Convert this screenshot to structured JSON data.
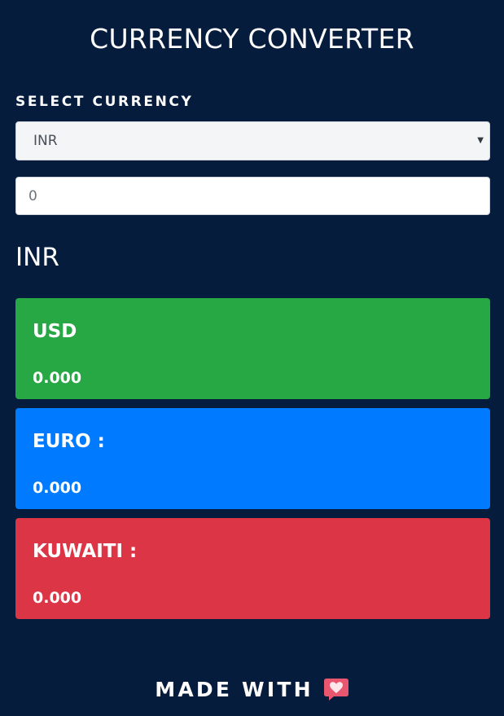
{
  "header": {
    "title": "CURRENCY CONVERTER"
  },
  "form": {
    "select_label": "SELECT CURRENCY",
    "selected_currency": "INR",
    "amount_placeholder": "0"
  },
  "result": {
    "heading": "INR"
  },
  "cards": [
    {
      "name": "USD",
      "value": "0.000",
      "color": "#28a745"
    },
    {
      "name": "EURO :",
      "value": "0.000",
      "color": "#007bff"
    },
    {
      "name": "KUWAITI :",
      "value": "0.000",
      "color": "#dc3545"
    }
  ],
  "footer": {
    "text": "MADE WITH",
    "icon": "heart-speech-bubble-icon"
  },
  "theme": {
    "background": "#051c3d"
  }
}
